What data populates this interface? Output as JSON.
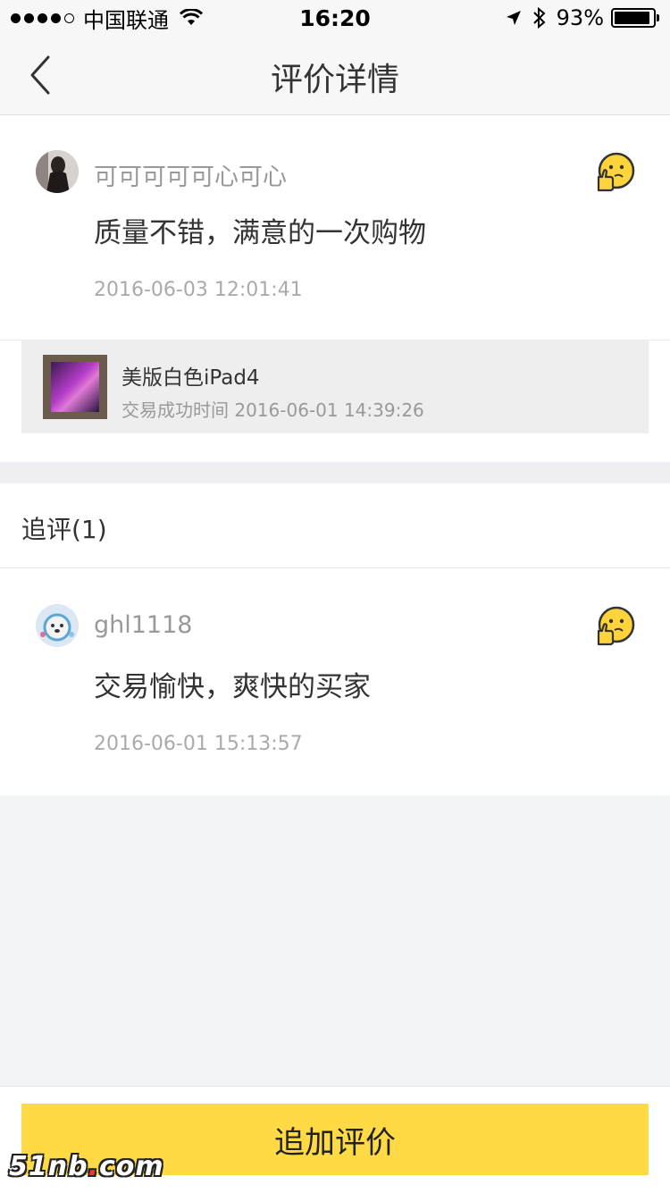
{
  "status_bar": {
    "carrier": "中国联通",
    "time": "16:20",
    "battery_percent": "93%",
    "battery_level": 0.93,
    "signal_bars": 4,
    "icons": [
      "wifi-icon",
      "location-arrow-icon",
      "bluetooth-icon",
      "battery-icon"
    ]
  },
  "nav": {
    "title": "评价详情",
    "back_icon": "chevron-left-icon"
  },
  "review": {
    "username": "可可可可可心可心",
    "comment": "质量不错，满意的一次购物",
    "time": "2016-06-03 12:01:41",
    "rating_icon": "thumbs-up-face-emoji-icon"
  },
  "product": {
    "title": "美版白色iPad4",
    "subtitle": "交易成功时间 2016-06-01 14:39:26"
  },
  "follow_up": {
    "label": "追评(1)",
    "items": [
      {
        "username": "ghl1118",
        "comment": "交易愉快，爽快的买家",
        "time": "2016-06-01 15:13:57",
        "rating_icon": "thumbs-up-face-emoji-icon"
      }
    ]
  },
  "bottom": {
    "button_label": "追加评价"
  },
  "watermark": {
    "text_a": "51nb",
    "dot": ".",
    "text_b": "com"
  },
  "colors": {
    "accent_yellow": "#ffda44",
    "page_bg": "#f3f4f8",
    "muted_text": "#999999"
  }
}
